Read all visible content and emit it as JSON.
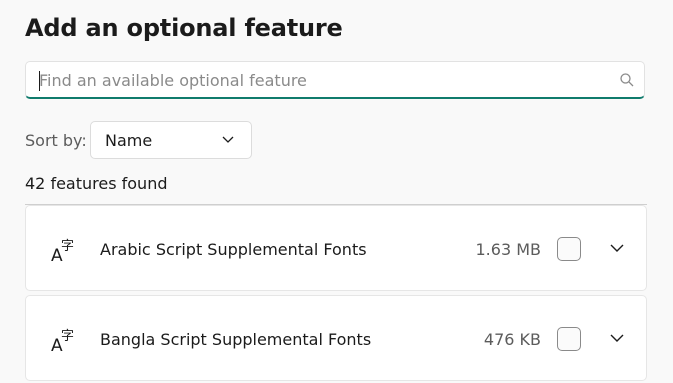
{
  "page": {
    "title": "Add an optional feature"
  },
  "search": {
    "placeholder": "Find an available optional feature",
    "value": ""
  },
  "sort": {
    "label": "Sort by:",
    "selected": "Name"
  },
  "results": {
    "count_text": "42 features found"
  },
  "features": [
    {
      "name": "Arabic Script Supplemental Fonts",
      "size": "1.63 MB",
      "checked": false,
      "icon": "font-icon"
    },
    {
      "name": "Bangla Script Supplemental Fonts",
      "size": "476 KB",
      "checked": false,
      "icon": "font-icon"
    }
  ],
  "colors": {
    "accent": "#0f7b6c"
  }
}
